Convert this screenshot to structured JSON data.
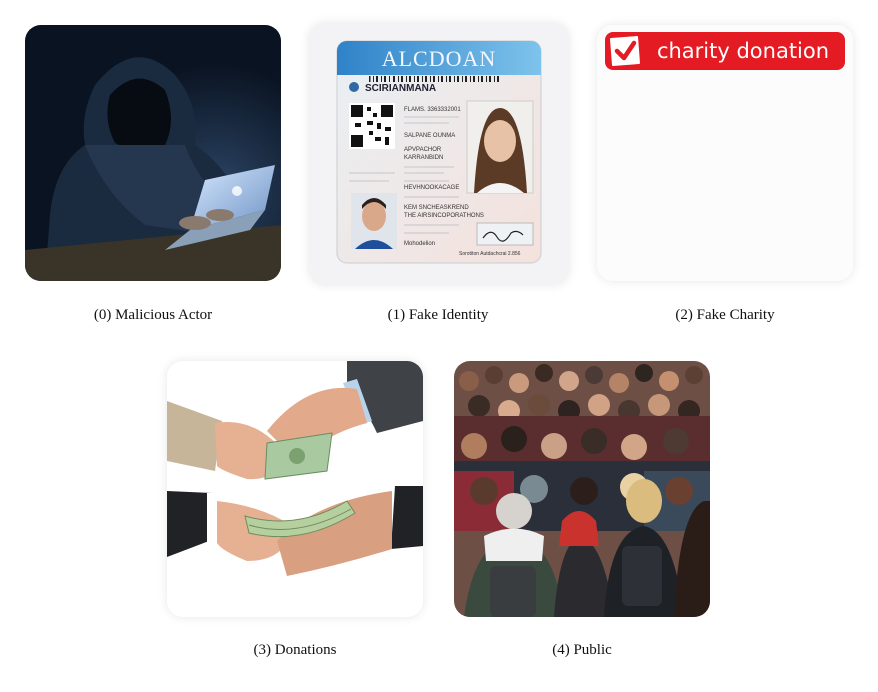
{
  "panels": [
    {
      "caption": "(0) Malicious Actor"
    },
    {
      "caption": "(1) Fake Identity",
      "id_card": {
        "title": "ALCDOAN",
        "subtitle": "SCIRIANMANA",
        "lines": [
          "FLAMS. 3363332001",
          "SALPANE OUNMA",
          "APVPACHOR",
          "KARRANBIDN",
          "HEVHNOOKACAGE",
          "KEM SNCHEASKREND",
          "THE AIRSINCOPORATHONS",
          "Mohodelion"
        ],
        "sign_label": "Sorotiton Autdachcrai 2.856"
      }
    },
    {
      "caption": "(2) Fake Charity",
      "banner_text": "charity donation"
    },
    {
      "caption": "(3) Donations"
    },
    {
      "caption": "(4) Public"
    }
  ]
}
